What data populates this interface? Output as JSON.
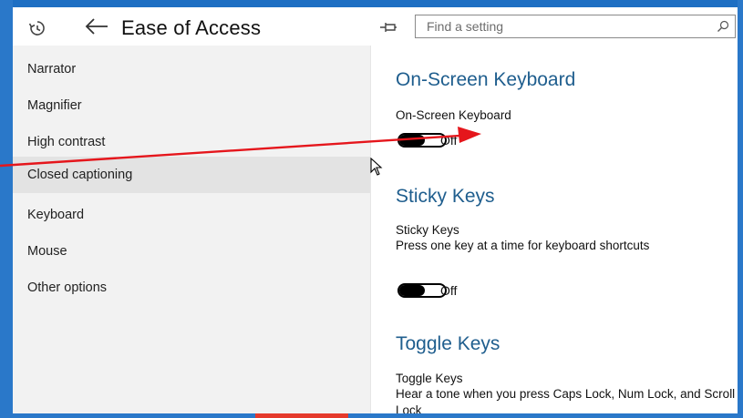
{
  "header": {
    "title": "Ease of Access",
    "search_placeholder": "Find a setting"
  },
  "sidebar": {
    "items": [
      {
        "label": "Narrator",
        "selected": false
      },
      {
        "label": "Magnifier",
        "selected": false
      },
      {
        "label": "High contrast",
        "selected": false
      },
      {
        "label": "Closed captioning",
        "selected": true
      },
      {
        "label": "Keyboard",
        "selected": false
      },
      {
        "label": "Mouse",
        "selected": false
      },
      {
        "label": "Other options",
        "selected": false
      }
    ]
  },
  "main": {
    "onscreen": {
      "title": "On-Screen Keyboard",
      "label": "On-Screen Keyboard",
      "state": "Off"
    },
    "sticky": {
      "title": "Sticky Keys",
      "label": "Sticky Keys",
      "description": "Press one key at a time for keyboard shortcuts",
      "state": "Off"
    },
    "toggle": {
      "title": "Toggle Keys",
      "label": "Toggle Keys",
      "description": "Hear a tone when you press Caps Lock, Num Lock, and Scroll Lock"
    }
  },
  "colors": {
    "accent": "#1f5e8e",
    "frame_blue": "#2a78c9",
    "annotation_red": "#e5161c",
    "sidebar_bg": "#f2f2f2",
    "selected_bg": "#e3e3e3"
  },
  "icons": [
    "history-icon",
    "back-arrow-icon",
    "pin-icon",
    "search-icon",
    "mouse-cursor-icon"
  ]
}
